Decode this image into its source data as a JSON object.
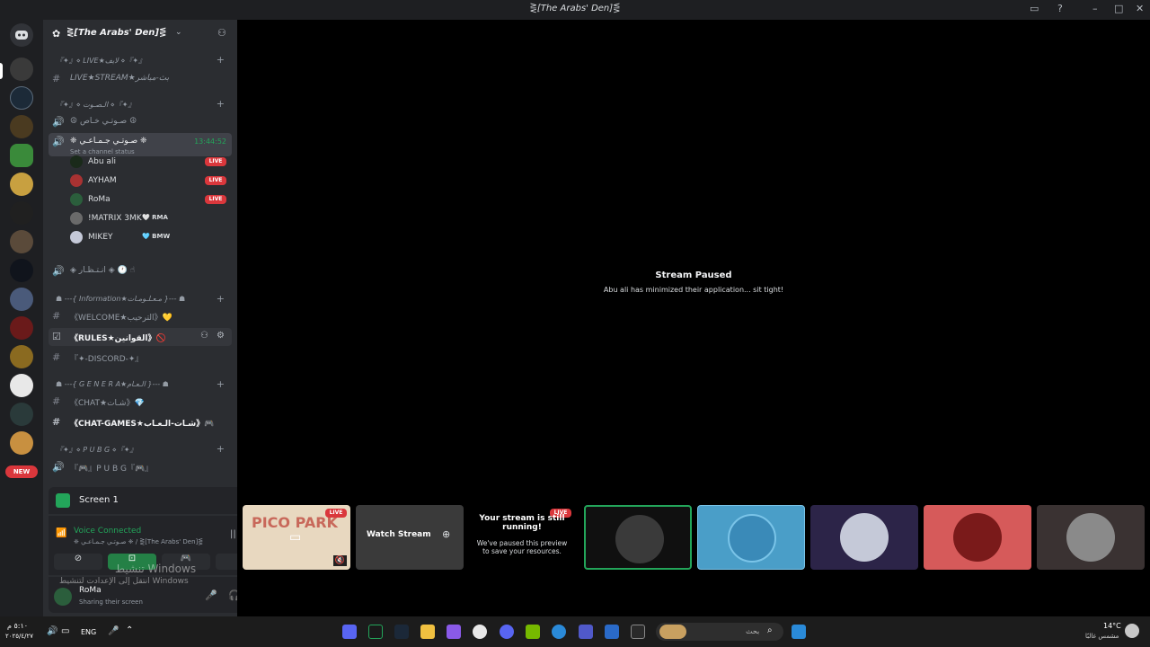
{
  "window": {
    "title": "⋛[The Arabs' Den]⋚",
    "inbox_icon": "inbox-icon",
    "help_icon": "help-icon"
  },
  "guild": {
    "name": "⋛[The Arabs' Den]⋚"
  },
  "channels": {
    "cat_live": "『✦』⋄ LIVE★لايف ⋄『✦』",
    "live_stream": "LIVE★STREAM★بث-مباشر",
    "cat_voice": "『✦』⋄ الـصـوت ⋄『✦』",
    "private_voice": "☮ صـوتـي خـاص ☮",
    "group_voice": "❈ صـوتـي جـمـاعـي ❈",
    "group_voice_timer": "13:44:52",
    "channel_status": "Set a channel status",
    "waiting": "◈ انـتـظـار ◈ 🕐 ☝",
    "cat_info": "☗ ---{ Information★مـعـلـومـات }--- ☗",
    "welcome": "《WELCOME★الترحيب》💛",
    "rules": "《RULES★القوانين》🚫",
    "discord": "『✦-DISCORD-✦』",
    "cat_general": "☗ ---{ G E N E R A★الـعـام }--- ☗",
    "chat": "《CHAT★شـات》💎",
    "chat_games": "《CHAT-GAMES★شـات-الـعـاب》🎮",
    "cat_pubg": "『✦』⋄ P U B G ⋄『✦』",
    "pubg": "『🎮』P U B G『🎮』",
    "new_badge": "NEW"
  },
  "voice_users": [
    {
      "name": "Abu ali",
      "live": "LIVE",
      "color": "#1a2a1a"
    },
    {
      "name": "AYHAM",
      "live": "LIVE",
      "color": "#a83232"
    },
    {
      "name": "RoMa",
      "live": "LIVE",
      "color": "#2b5e3c"
    },
    {
      "name": "!MATRIX 3MK",
      "tag": "🤍 RMA",
      "color": "#6a6a6a"
    },
    {
      "name": "MIKEY",
      "tag": "🩵 BMW",
      "color": "#c5c9d8"
    }
  ],
  "screen_panel": {
    "title": "Screen 1"
  },
  "voice_panel": {
    "status": "Voice Connected",
    "location": "❈ صـوتـي جـمـاعـي ❈ / ⋛[The Arabs' Den]⋚"
  },
  "user_panel": {
    "name": "RoMa",
    "status": "Sharing their screen"
  },
  "watermark": {
    "line1": "تنشيط Windows",
    "line2": "انتقل إلى الإعدادت لتنشيط Windows"
  },
  "stream": {
    "paused_title": "Stream Paused",
    "paused_sub": "Abu ali has minimized their application... sit tight!"
  },
  "tiles": {
    "pico": "PICO PARK",
    "live": "LIVE",
    "watch": "Watch Stream",
    "still_running_title": "Your stream is still running!",
    "still_running_sub": "We've paused this preview to save your resources."
  },
  "taskbar": {
    "time": "٥:١٠ م",
    "date": "٢٠٢٥/٤/٢٧",
    "lang": "ENG",
    "search": "بحث",
    "weather_temp": "14°C",
    "weather_desc": "مشمس غالبًا"
  }
}
